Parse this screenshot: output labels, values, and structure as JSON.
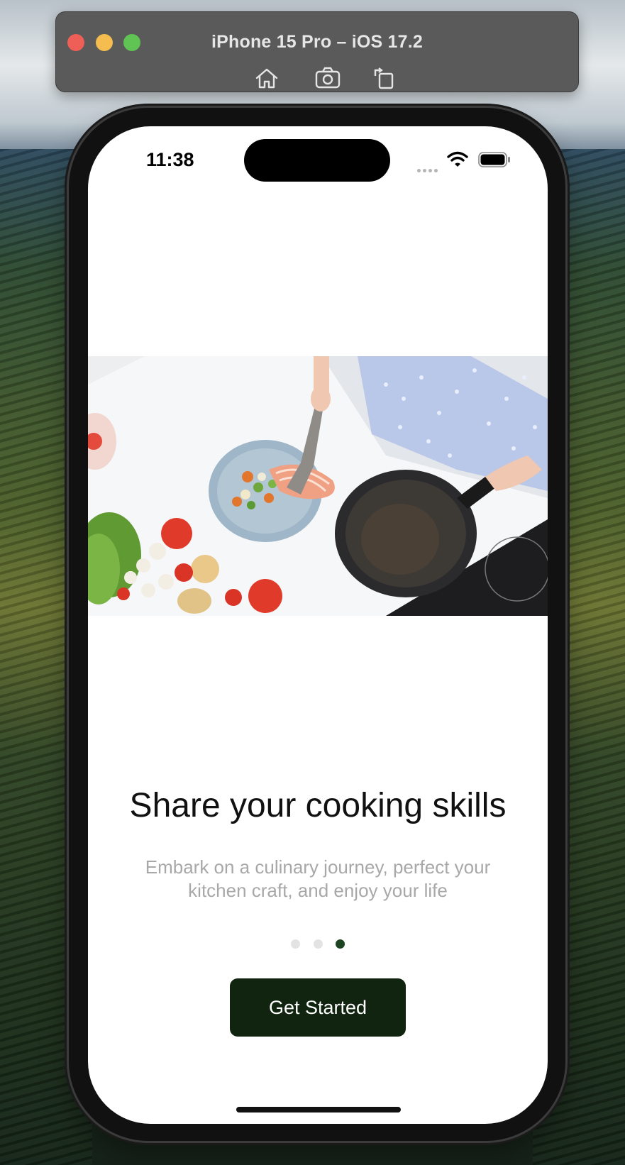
{
  "simulator": {
    "title": "iPhone 15 Pro – iOS 17.2",
    "tools": [
      "home-icon",
      "screenshot-icon",
      "rotate-icon"
    ],
    "traffic_colors": {
      "close": "#ee5f57",
      "minimize": "#f5bd4f",
      "zoom": "#5fc454"
    }
  },
  "status_bar": {
    "time": "11:38",
    "icons": [
      "signal-icon",
      "wifi-icon",
      "battery-icon"
    ]
  },
  "onboarding": {
    "title": "Share your cooking skills",
    "subtitle": "Embark on a culinary journey, perfect your kitchen craft, and enjoy your life",
    "page_count": 3,
    "active_page": 3,
    "button_label": "Get Started",
    "colors": {
      "button": "#10240f",
      "active_dot": "#1d4422",
      "inactive_dot": "#e3e3e3",
      "subtitle": "#a8a8a8"
    }
  }
}
